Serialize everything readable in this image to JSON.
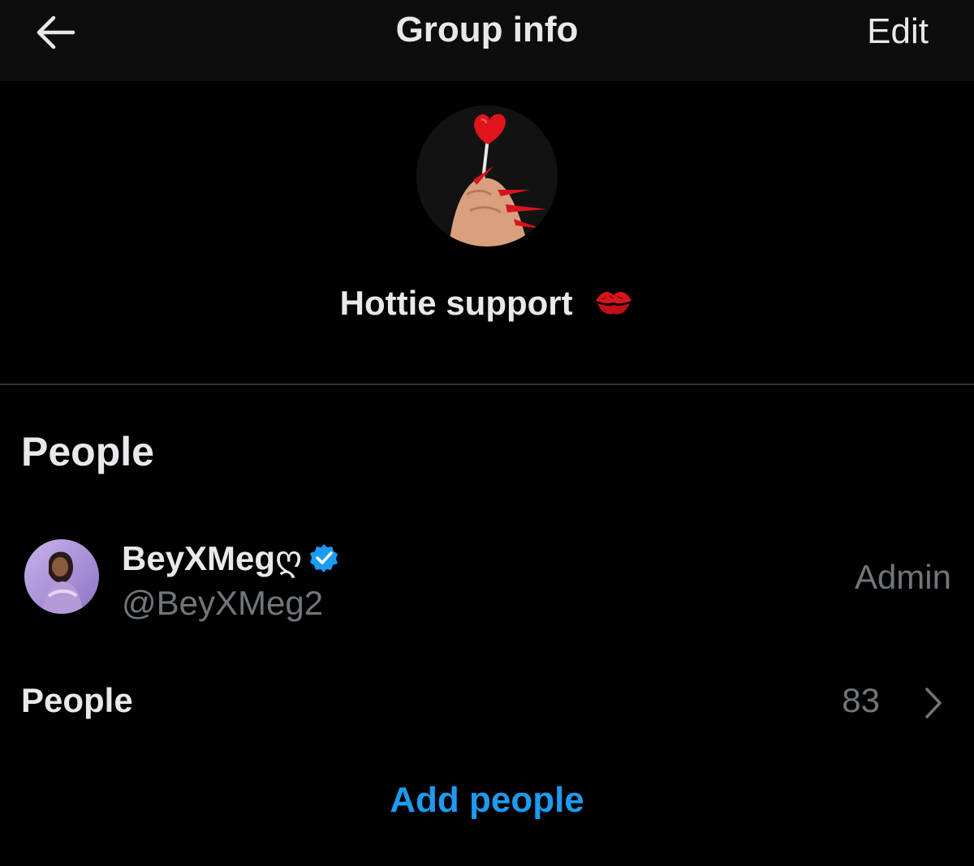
{
  "header": {
    "title": "Group info",
    "edit_label": "Edit",
    "back_icon": "arrow-left-icon"
  },
  "group": {
    "name": "Hottie support",
    "emoji_icon": "kiss-mark-icon",
    "avatar_icon": "lollipop-hand-avatar"
  },
  "people_section": {
    "title": "People",
    "members": [
      {
        "name": "BeyXMeg",
        "name_suffix": "ღ",
        "handle": "@BeyXMeg2",
        "role": "Admin",
        "verified_icon": "verified-badge-icon"
      }
    ],
    "people_row": {
      "label": "People",
      "count": "83",
      "chevron_icon": "chevron-right-icon"
    },
    "add_people_label": "Add people"
  },
  "colors": {
    "background": "#000000",
    "header_background": "#0d0d0d",
    "text_primary": "#e7e9ea",
    "text_secondary": "#71767b",
    "accent": "#1d9bf0",
    "divider": "#2f3336"
  }
}
